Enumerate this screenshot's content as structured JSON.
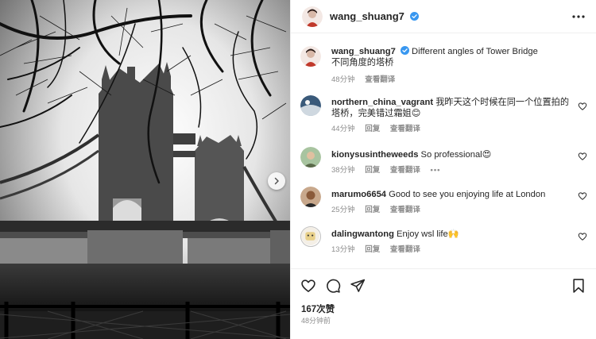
{
  "post": {
    "author": "wang_shuang7",
    "verified": true,
    "caption_en": "Different angles of Tower Bridge",
    "caption_zh": "不同角度的塔桥",
    "caption_time": "48分钟",
    "see_translation": "查看翻译",
    "image_alt": "Black and white photo of Tower Bridge in London framed by bare tree branches"
  },
  "comments": [
    {
      "user": "northern_china_vagrant",
      "text": "我昨天这个时候在同一个位置拍的塔桥，完美错过霜姐😊",
      "time": "44分钟",
      "reply": "回复",
      "translate": "查看翻译",
      "more": ""
    },
    {
      "user": "kionysusintheweeds",
      "text": "So professional😍",
      "time": "38分钟",
      "reply": "回复",
      "translate": "查看翻译",
      "more": "•••"
    },
    {
      "user": "marumo6654",
      "text": "Good to see you enjoying life at London",
      "time": "25分钟",
      "reply": "回复",
      "translate": "查看翻译",
      "more": ""
    },
    {
      "user": "dalingwantong",
      "text": "Enjoy wsl life🙌",
      "time": "13分钟",
      "reply": "回复",
      "translate": "查看翻译",
      "more": ""
    }
  ],
  "footer": {
    "likes": "167次赞",
    "posted": "48分钟前"
  },
  "icons": {
    "more": "more-horizontal-icon",
    "like": "heart-icon",
    "comment": "comment-bubble-icon",
    "share": "paper-plane-icon",
    "save": "bookmark-icon",
    "next": "chevron-right-icon"
  },
  "colors": {
    "verified": "#3897f0",
    "text": "#262626",
    "secondary": "#8e8e8e",
    "divider": "#efefef"
  }
}
